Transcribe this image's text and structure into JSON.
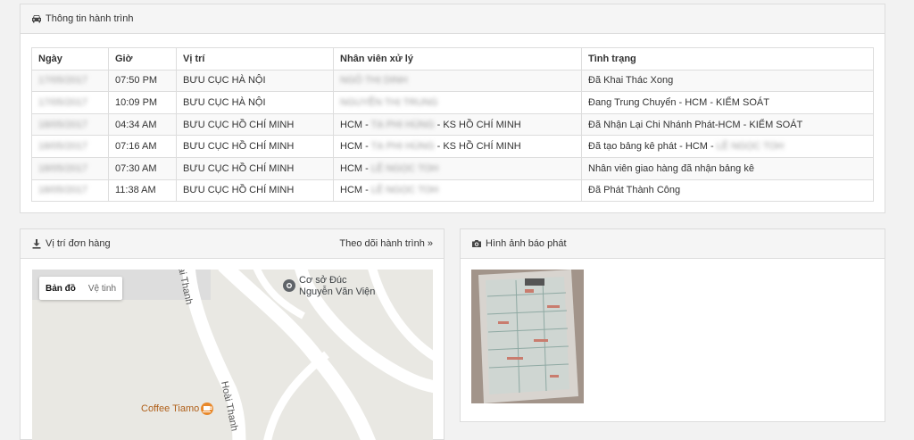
{
  "trip": {
    "title": "Thông tin hành trình",
    "headers": [
      "Ngày",
      "Giờ",
      "Vị trí",
      "Nhân viên xử lý",
      "Tình trạng"
    ],
    "rows": [
      {
        "date": "17/05/2017",
        "time": "07:50 PM",
        "location": "BƯU CỤC HÀ NỘI",
        "staff_prefix": "",
        "staff_hidden": "NGÔ THỊ DINH",
        "staff_suffix": "",
        "status": "Đã Khai Thác Xong",
        "status_hidden": ""
      },
      {
        "date": "17/05/2017",
        "time": "10:09 PM",
        "location": "BƯU CỤC HÀ NỘI",
        "staff_prefix": "",
        "staff_hidden": "NGUYỄN THỊ TRUNG",
        "staff_suffix": "",
        "status": "Đang Trung Chuyển - HCM - KIỂM SOÁT",
        "status_hidden": ""
      },
      {
        "date": "18/05/2017",
        "time": "04:34 AM",
        "location": "BƯU CỤC HỒ CHÍ MINH",
        "staff_prefix": "HCM - ",
        "staff_hidden": "TẠ PHI HÙNG",
        "staff_suffix": " - KS HỒ CHÍ MINH",
        "status": "Đã Nhận Lại Chi Nhánh Phát-HCM - KIỂM SOÁT",
        "status_hidden": ""
      },
      {
        "date": "18/05/2017",
        "time": "07:16 AM",
        "location": "BƯU CỤC HỒ CHÍ MINH",
        "staff_prefix": "HCM - ",
        "staff_hidden": "TẠ PHI HÙNG",
        "staff_suffix": " - KS HỒ CHÍ MINH",
        "status": "Đã tạo bảng kê phát - HCM - ",
        "status_hidden": "LÊ NGỌC TOH"
      },
      {
        "date": "18/05/2017",
        "time": "07:30 AM",
        "location": "BƯU CỤC HỒ CHÍ MINH",
        "staff_prefix": "HCM - ",
        "staff_hidden": "LÊ NGỌC TOH",
        "staff_suffix": "",
        "status": "Nhân viên giao hàng đã nhận bảng kê",
        "status_hidden": ""
      },
      {
        "date": "18/05/2017",
        "time": "11:38 AM",
        "location": "BƯU CỤC HỒ CHÍ MINH",
        "staff_prefix": "HCM - ",
        "staff_hidden": "LÊ NGỌC TOH",
        "staff_suffix": "",
        "status": "Đã Phát Thành Công",
        "status_hidden": ""
      }
    ]
  },
  "location": {
    "title": "Vị trí đơn hàng",
    "track_link": "Theo dõi hành trình »",
    "map_tabs": [
      "Bản đồ",
      "Vệ tinh"
    ],
    "road_label_1": "ai Thanh",
    "road_label_2": "Hoài Thanh",
    "poi_1_line1": "Cơ sở Đúc",
    "poi_1_line2": "Nguyễn Văn Viện",
    "poi_2": "Coffee Tiamo"
  },
  "photo": {
    "title": "Hình ảnh báo phát"
  },
  "colors": {
    "road": "#ffffff",
    "land": "#e9e8e3",
    "poi_dark": "#5f6368",
    "poi_cafe": "#e8892c"
  }
}
